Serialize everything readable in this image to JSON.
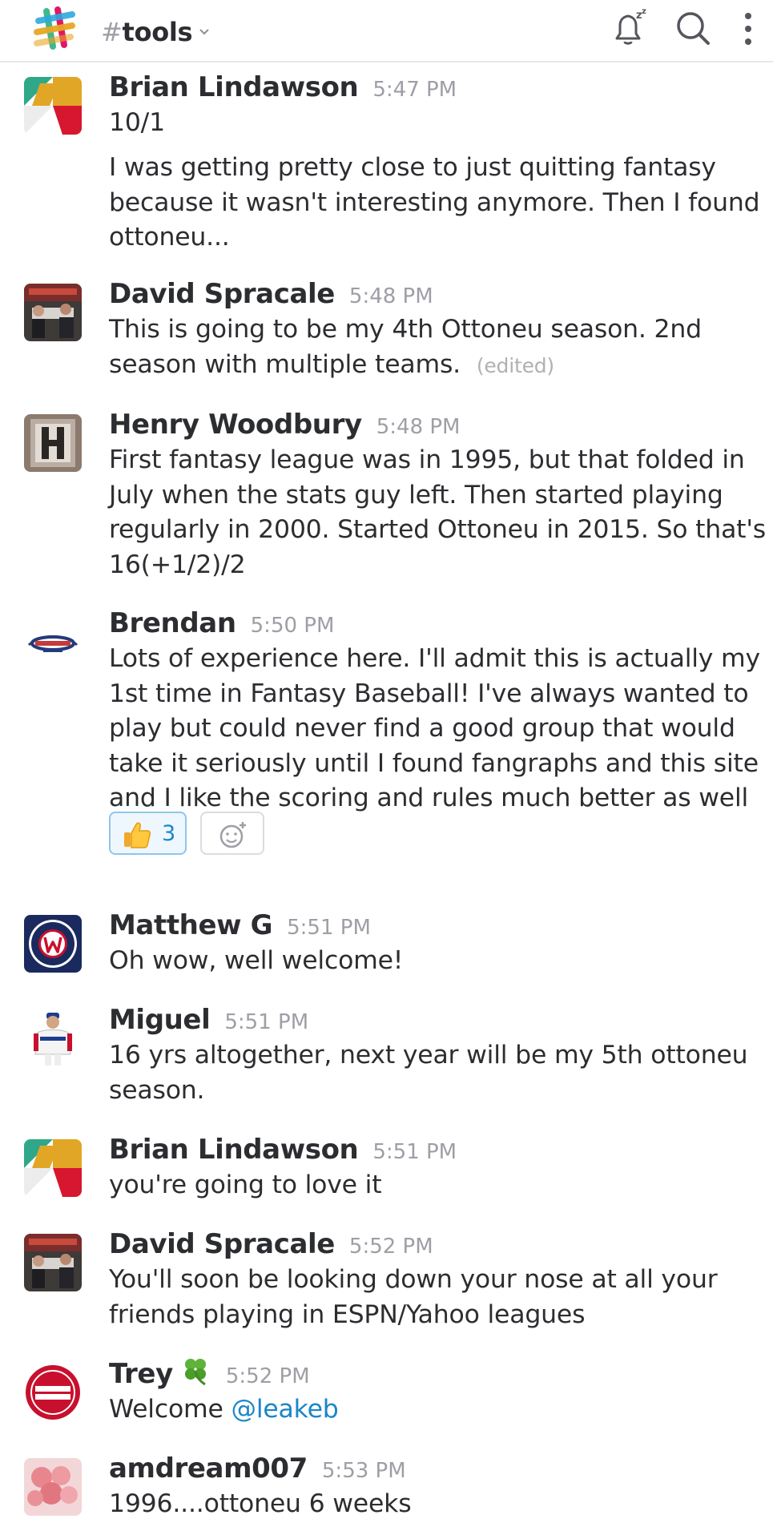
{
  "header": {
    "hash": "#",
    "channel": "tools"
  },
  "messages": [
    {
      "author": "Brian Lindawson",
      "time": "5:47 PM",
      "lines": [
        "10/1"
      ]
    },
    {
      "text": "I was getting pretty close to just quitting fantasy because it wasn't interesting anymore. Then I found ottoneu..."
    },
    {
      "author": "David Spracale",
      "time": "5:48 PM",
      "text": "This is going to be my 4th Ottoneu season. 2nd season with multiple teams.",
      "edited": "(edited)"
    },
    {
      "author": "Henry Woodbury",
      "time": "5:48 PM",
      "text": "First fantasy league was in 1995, but that folded in July when the stats guy left. Then started playing regularly in 2000. Started Ottoneu in 2015. So that's 16(+1/2)/2"
    },
    {
      "author": "Brendan",
      "time": "5:50 PM",
      "text": "Lots of experience here. I'll admit this is actually my 1st time in Fantasy Baseball! I've always wanted to play but could never find a good group that would take it seriously until I found fangraphs and this site and I like the scoring and rules much better as well",
      "reaction": {
        "emoji": "thumbs-up",
        "count": "3"
      }
    },
    {
      "author": "Matthew G",
      "time": "5:51 PM",
      "text": "Oh wow, well welcome!"
    },
    {
      "author": "Miguel",
      "time": "5:51 PM",
      "text": "16 yrs altogether, next year will be my 5th ottoneu season."
    },
    {
      "author": "Brian Lindawson",
      "time": "5:51 PM",
      "text": "you're going to love it"
    },
    {
      "author": "David Spracale",
      "time": "5:52 PM",
      "text": "You'll soon be looking down your nose at all your friends playing in ESPN/Yahoo leagues"
    },
    {
      "author": "Trey",
      "time": "5:52 PM",
      "text_prefix": "Welcome ",
      "mention": "@leakeb"
    },
    {
      "author": "amdream007",
      "time": "5:53 PM",
      "text": "1996....ottoneu 6 weeks"
    }
  ],
  "colors": {
    "text": "#2c2d30",
    "muted": "#9e9ea6",
    "link": "#1a86c8",
    "reaction_border": "#8fc6ea",
    "reaction_bg": "#eef7fd"
  },
  "icons": [
    "slack-logo-icon",
    "chevron-down-icon",
    "snooze-bell-icon",
    "search-icon",
    "more-vertical-icon",
    "thumbs-up-icon",
    "add-reaction-icon",
    "four-leaf-clover-icon"
  ]
}
